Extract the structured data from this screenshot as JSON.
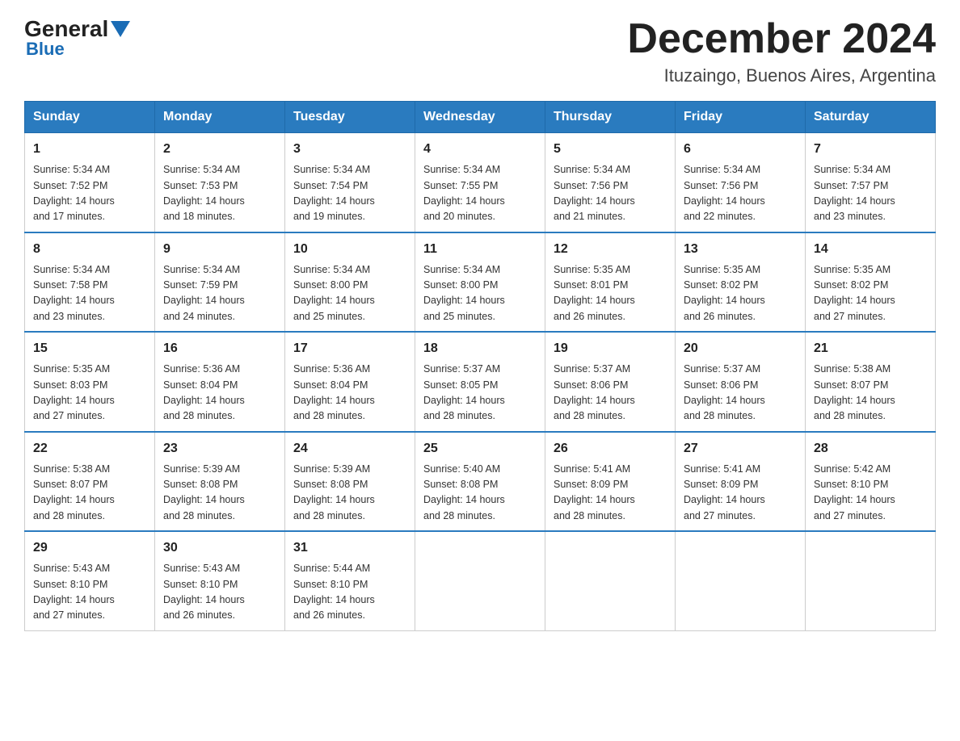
{
  "header": {
    "logo_general": "General",
    "logo_blue": "Blue",
    "title": "December 2024",
    "subtitle": "Ituzaingo, Buenos Aires, Argentina"
  },
  "weekdays": [
    "Sunday",
    "Monday",
    "Tuesday",
    "Wednesday",
    "Thursday",
    "Friday",
    "Saturday"
  ],
  "weeks": [
    [
      {
        "day": "1",
        "sunrise": "5:34 AM",
        "sunset": "7:52 PM",
        "daylight": "14 hours and 17 minutes."
      },
      {
        "day": "2",
        "sunrise": "5:34 AM",
        "sunset": "7:53 PM",
        "daylight": "14 hours and 18 minutes."
      },
      {
        "day": "3",
        "sunrise": "5:34 AM",
        "sunset": "7:54 PM",
        "daylight": "14 hours and 19 minutes."
      },
      {
        "day": "4",
        "sunrise": "5:34 AM",
        "sunset": "7:55 PM",
        "daylight": "14 hours and 20 minutes."
      },
      {
        "day": "5",
        "sunrise": "5:34 AM",
        "sunset": "7:56 PM",
        "daylight": "14 hours and 21 minutes."
      },
      {
        "day": "6",
        "sunrise": "5:34 AM",
        "sunset": "7:56 PM",
        "daylight": "14 hours and 22 minutes."
      },
      {
        "day": "7",
        "sunrise": "5:34 AM",
        "sunset": "7:57 PM",
        "daylight": "14 hours and 23 minutes."
      }
    ],
    [
      {
        "day": "8",
        "sunrise": "5:34 AM",
        "sunset": "7:58 PM",
        "daylight": "14 hours and 23 minutes."
      },
      {
        "day": "9",
        "sunrise": "5:34 AM",
        "sunset": "7:59 PM",
        "daylight": "14 hours and 24 minutes."
      },
      {
        "day": "10",
        "sunrise": "5:34 AM",
        "sunset": "8:00 PM",
        "daylight": "14 hours and 25 minutes."
      },
      {
        "day": "11",
        "sunrise": "5:34 AM",
        "sunset": "8:00 PM",
        "daylight": "14 hours and 25 minutes."
      },
      {
        "day": "12",
        "sunrise": "5:35 AM",
        "sunset": "8:01 PM",
        "daylight": "14 hours and 26 minutes."
      },
      {
        "day": "13",
        "sunrise": "5:35 AM",
        "sunset": "8:02 PM",
        "daylight": "14 hours and 26 minutes."
      },
      {
        "day": "14",
        "sunrise": "5:35 AM",
        "sunset": "8:02 PM",
        "daylight": "14 hours and 27 minutes."
      }
    ],
    [
      {
        "day": "15",
        "sunrise": "5:35 AM",
        "sunset": "8:03 PM",
        "daylight": "14 hours and 27 minutes."
      },
      {
        "day": "16",
        "sunrise": "5:36 AM",
        "sunset": "8:04 PM",
        "daylight": "14 hours and 28 minutes."
      },
      {
        "day": "17",
        "sunrise": "5:36 AM",
        "sunset": "8:04 PM",
        "daylight": "14 hours and 28 minutes."
      },
      {
        "day": "18",
        "sunrise": "5:37 AM",
        "sunset": "8:05 PM",
        "daylight": "14 hours and 28 minutes."
      },
      {
        "day": "19",
        "sunrise": "5:37 AM",
        "sunset": "8:06 PM",
        "daylight": "14 hours and 28 minutes."
      },
      {
        "day": "20",
        "sunrise": "5:37 AM",
        "sunset": "8:06 PM",
        "daylight": "14 hours and 28 minutes."
      },
      {
        "day": "21",
        "sunrise": "5:38 AM",
        "sunset": "8:07 PM",
        "daylight": "14 hours and 28 minutes."
      }
    ],
    [
      {
        "day": "22",
        "sunrise": "5:38 AM",
        "sunset": "8:07 PM",
        "daylight": "14 hours and 28 minutes."
      },
      {
        "day": "23",
        "sunrise": "5:39 AM",
        "sunset": "8:08 PM",
        "daylight": "14 hours and 28 minutes."
      },
      {
        "day": "24",
        "sunrise": "5:39 AM",
        "sunset": "8:08 PM",
        "daylight": "14 hours and 28 minutes."
      },
      {
        "day": "25",
        "sunrise": "5:40 AM",
        "sunset": "8:08 PM",
        "daylight": "14 hours and 28 minutes."
      },
      {
        "day": "26",
        "sunrise": "5:41 AM",
        "sunset": "8:09 PM",
        "daylight": "14 hours and 28 minutes."
      },
      {
        "day": "27",
        "sunrise": "5:41 AM",
        "sunset": "8:09 PM",
        "daylight": "14 hours and 27 minutes."
      },
      {
        "day": "28",
        "sunrise": "5:42 AM",
        "sunset": "8:10 PM",
        "daylight": "14 hours and 27 minutes."
      }
    ],
    [
      {
        "day": "29",
        "sunrise": "5:43 AM",
        "sunset": "8:10 PM",
        "daylight": "14 hours and 27 minutes."
      },
      {
        "day": "30",
        "sunrise": "5:43 AM",
        "sunset": "8:10 PM",
        "daylight": "14 hours and 26 minutes."
      },
      {
        "day": "31",
        "sunrise": "5:44 AM",
        "sunset": "8:10 PM",
        "daylight": "14 hours and 26 minutes."
      },
      null,
      null,
      null,
      null
    ]
  ],
  "labels": {
    "sunrise": "Sunrise:",
    "sunset": "Sunset:",
    "daylight": "Daylight:"
  }
}
